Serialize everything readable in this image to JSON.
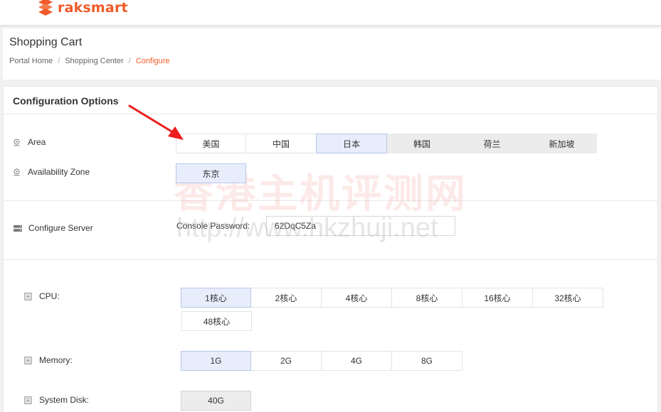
{
  "brand": {
    "name": "raksmart",
    "color": "#f05a28"
  },
  "header": {
    "title": "Shopping Cart",
    "breadcrumb": [
      "Portal Home",
      "Shopping Center",
      "Configure"
    ]
  },
  "config": {
    "title": "Configuration Options",
    "area": {
      "label": "Area",
      "icon": "location-pin-icon",
      "options": [
        "美国",
        "中国",
        "日本",
        "韩国",
        "荷兰",
        "新加坡"
      ],
      "selected": "日本"
    },
    "zone": {
      "label": "Availability Zone",
      "icon": "location-pin-icon",
      "options": [
        "东京"
      ],
      "selected": "东京"
    },
    "server": {
      "label": "Configure Server",
      "icon": "server-icon",
      "password_label": "Console Password:",
      "password_value": "62DqC5Za"
    },
    "cpu": {
      "label": "CPU:",
      "icon": "list-icon",
      "options": [
        "1核心",
        "2核心",
        "4核心",
        "8核心",
        "16核心",
        "32核心",
        "48核心"
      ],
      "selected": "1核心"
    },
    "memory": {
      "label": "Memory:",
      "icon": "list-icon",
      "options": [
        "1G",
        "2G",
        "4G",
        "8G"
      ],
      "selected": "1G"
    },
    "disk": {
      "label": "System Disk:",
      "icon": "list-icon",
      "options": [
        "40G"
      ],
      "selected": "40G"
    }
  },
  "watermark": {
    "title": "香港主机评测网",
    "url": "http://www.hkzhuji.net"
  },
  "annotation_color": "#ee1c1c"
}
